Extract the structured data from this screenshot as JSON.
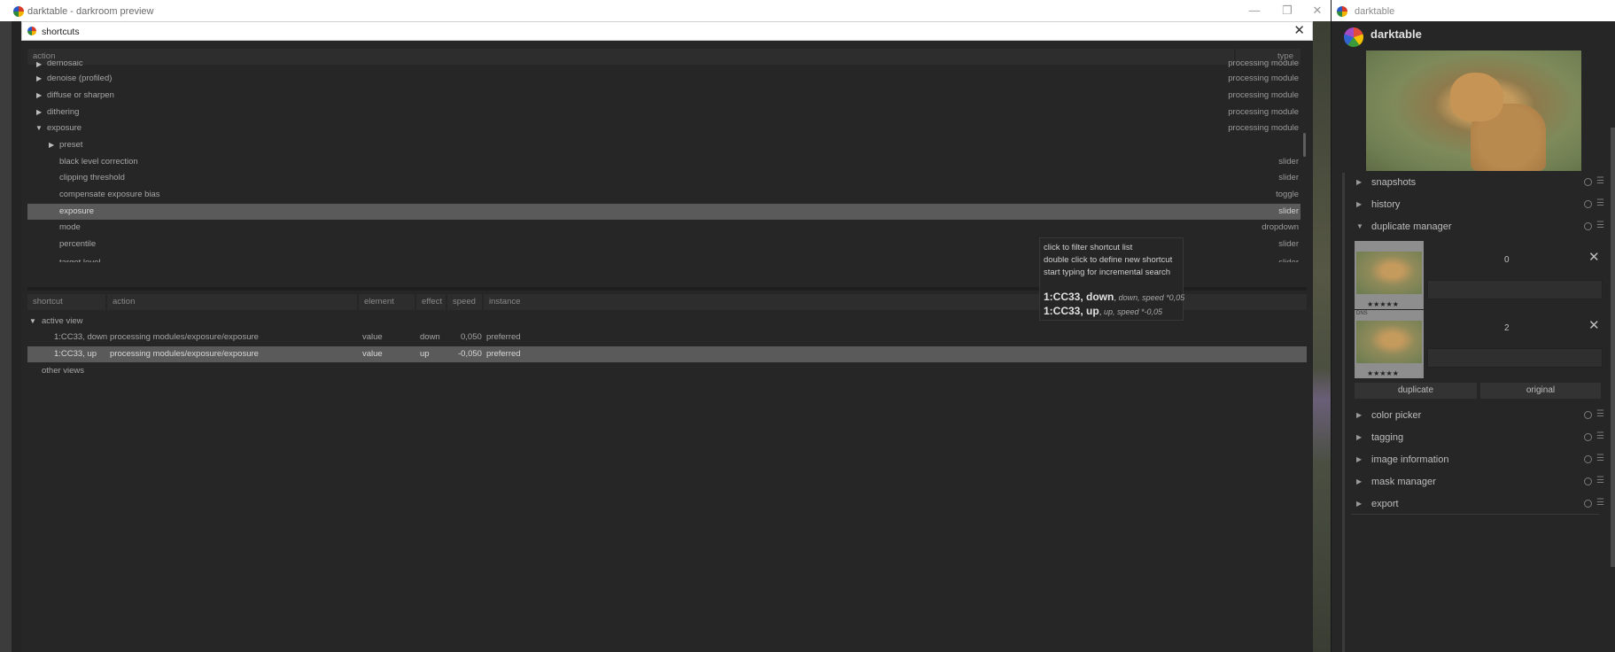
{
  "left_window": {
    "title": "darktable - darkroom preview",
    "controls": {
      "minimize": "—",
      "restore": "❐",
      "close": "✕"
    }
  },
  "dialog": {
    "title": "shortcuts",
    "close_icon": "✕",
    "tree_headers": {
      "action": "action",
      "type": "type"
    },
    "tree_rows": [
      {
        "label": "demosaic",
        "type": "processing module",
        "expander": "collapsed"
      },
      {
        "label": "denoise (profiled)",
        "type": "processing module",
        "expander": "collapsed"
      },
      {
        "label": "diffuse or sharpen",
        "type": "processing module",
        "expander": "collapsed"
      },
      {
        "label": "dithering",
        "type": "processing module",
        "expander": "collapsed"
      },
      {
        "label": "exposure",
        "type": "processing module",
        "expander": "expanded"
      },
      {
        "label": "preset",
        "type": "",
        "expander": "collapsed"
      },
      {
        "label": "black level correction",
        "type": "slider",
        "expander": "none"
      },
      {
        "label": "clipping threshold",
        "type": "slider",
        "expander": "none"
      },
      {
        "label": "compensate exposure bias",
        "type": "toggle",
        "expander": "none"
      },
      {
        "label": "exposure",
        "type": "slider",
        "expander": "none",
        "selected": true
      },
      {
        "label": "mode",
        "type": "dropdown",
        "expander": "none"
      },
      {
        "label": "percentile",
        "type": "slider",
        "expander": "none"
      },
      {
        "label": "target level",
        "type": "slider",
        "expander": "none"
      }
    ],
    "binding_headers": {
      "shortcut": "shortcut",
      "action": "action",
      "element": "element",
      "effect": "effect",
      "speed": "speed",
      "instance": "instance"
    },
    "active_view_label": "active view",
    "bindings": [
      {
        "shortcut": "1:CC33, down",
        "action": "processing modules/exposure/exposure",
        "element": "value",
        "effect": "down",
        "speed": "0,050",
        "instance": "preferred"
      },
      {
        "shortcut": "1:CC33, up",
        "action": "processing modules/exposure/exposure",
        "element": "value",
        "effect": "up",
        "speed": "-0,050",
        "instance": "preferred",
        "selected": true
      }
    ],
    "other_views_label": "other views"
  },
  "tooltip": {
    "line1": "click to filter shortcut list",
    "line2": "double click to define new shortcut",
    "line3": "start typing for incremental search",
    "entry1_key": "1:CC33, down",
    "entry1_detail": "down, speed *0,05",
    "entry2_key": "1:CC33, up",
    "entry2_detail": "up, speed *-0,05"
  },
  "right_window": {
    "title": "darktable",
    "brand": "darktable",
    "modules_top": [
      {
        "name": "snapshots"
      },
      {
        "name": "history"
      },
      {
        "name": "duplicate manager",
        "expanded": true
      }
    ],
    "duplicates": [
      {
        "version": "0",
        "stars": "★★★★★",
        "tag": ""
      },
      {
        "version": "2",
        "stars": "★★★★★",
        "tag": "DNS"
      }
    ],
    "duplicate_button": "duplicate",
    "original_button": "original",
    "modules_bottom": [
      {
        "name": "color picker"
      },
      {
        "name": "tagging"
      },
      {
        "name": "image information"
      },
      {
        "name": "mask manager"
      },
      {
        "name": "export"
      }
    ]
  },
  "colors": {
    "panel_bg": "#262626",
    "selected_row": "#5a5a5a",
    "text": "#a6a6a6"
  }
}
